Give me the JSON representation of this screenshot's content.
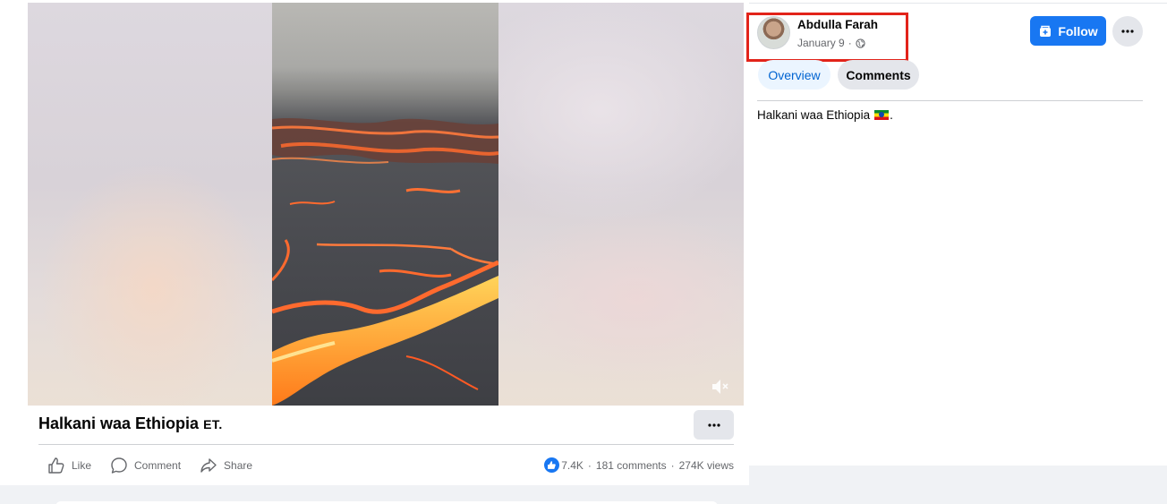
{
  "post": {
    "title": "Halkani waa Ethiopia",
    "title_flag_text": "ET.",
    "caption_text": "Halkani waa Ethiopia",
    "caption_end": "."
  },
  "video": {
    "mute_icon": "speaker-muted-icon",
    "title_more_icon": "ellipsis-icon"
  },
  "actions": {
    "like_label": "Like",
    "comment_label": "Comment",
    "share_label": "Share"
  },
  "stats": {
    "reactions": "7.4K",
    "comments": "181 comments",
    "views": "274K views",
    "separator": "·"
  },
  "author": {
    "name": "Abdulla Farah",
    "date": "January 9",
    "separator": "·",
    "privacy_icon": "globe-icon"
  },
  "buttons": {
    "follow_label": "Follow",
    "more_icon": "ellipsis-icon"
  },
  "tabs": [
    {
      "label": "Overview",
      "active": true
    },
    {
      "label": "Comments",
      "active": false
    }
  ],
  "colors": {
    "accent": "#1877f2",
    "highlight": "#e2231a",
    "active_tab_text": "#0064d1"
  }
}
